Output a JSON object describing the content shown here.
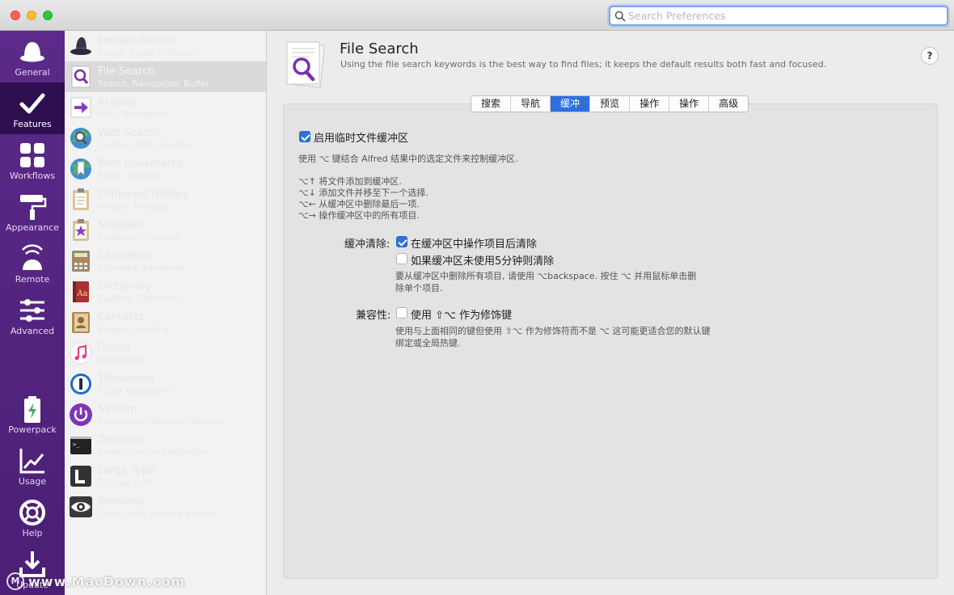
{
  "search": {
    "placeholder": "Search Preferences"
  },
  "sidebar": {
    "items": [
      {
        "label": "General",
        "icon": "hat-icon"
      },
      {
        "label": "Features",
        "icon": "checkmark-icon"
      },
      {
        "label": "Workflows",
        "icon": "grid-icon"
      },
      {
        "label": "Appearance",
        "icon": "paint-roller-icon"
      },
      {
        "label": "Remote",
        "icon": "remote-icon"
      },
      {
        "label": "Advanced",
        "icon": "sliders-icon"
      },
      {
        "label": "Powerpack",
        "icon": "battery-icon"
      },
      {
        "label": "Usage",
        "icon": "chart-icon"
      },
      {
        "label": "Help",
        "icon": "lifebuoy-icon"
      },
      {
        "label": "Update",
        "icon": "download-icon"
      }
    ]
  },
  "features": [
    {
      "title": "Default Results",
      "subtitle": "Scope, Types, Fallbacks",
      "icon": "wizard-hat-icon"
    },
    {
      "title": "File Search",
      "subtitle": "Search, Navigation, Buffer",
      "icon": "file-search-icon"
    },
    {
      "title": "Actions",
      "subtitle": "Files, Navigation",
      "icon": "arrow-right-icon"
    },
    {
      "title": "Web Search",
      "subtitle": "Custom, URLs, History",
      "icon": "globe-search-icon"
    },
    {
      "title": "Web Bookmarks",
      "subtitle": "Safari, Chrome",
      "icon": "globe-bookmark-icon"
    },
    {
      "title": "Clipboard History",
      "subtitle": "History, Merging",
      "icon": "clipboard-icon"
    },
    {
      "title": "Snippets",
      "subtitle": "Snippets, Clippings",
      "icon": "star-clipboard-icon"
    },
    {
      "title": "Calculator",
      "subtitle": "Standard, Advanced",
      "icon": "calculator-icon"
    },
    {
      "title": "Dictionary",
      "subtitle": "Spelling, Definitions",
      "icon": "dictionary-icon"
    },
    {
      "title": "Contacts",
      "subtitle": "Viewer, Emailing",
      "icon": "contacts-icon"
    },
    {
      "title": "iTunes",
      "subtitle": "Mini Player",
      "icon": "music-note-icon"
    },
    {
      "title": "1Password",
      "subtitle": "1Click Bookmarks",
      "icon": "onepassword-icon"
    },
    {
      "title": "System",
      "subtitle": "Commands, Quitting, Ejecting",
      "icon": "power-icon"
    },
    {
      "title": "Terminal",
      "subtitle": "Prefix, Custom Integration",
      "icon": "terminal-icon"
    },
    {
      "title": "Large Type",
      "subtitle": "Display, Font",
      "icon": "large-type-icon"
    },
    {
      "title": "Previews",
      "subtitle": "Quick Look, Preview panels",
      "icon": "eye-icon"
    }
  ],
  "header": {
    "title": "File Search",
    "description": "Using the file search keywords is the best way to find files; it keeps the default results both fast and focused.",
    "help": "?"
  },
  "tabs": [
    "搜索",
    "导航",
    "缓冲",
    "预览",
    "操作",
    "操作",
    "高级"
  ],
  "buffer": {
    "enable_label": "启用临时文件缓冲区",
    "enable_checked": true,
    "intro": "使用 ⌥ 键结合 Alfred 结果中的选定文件来控制缓冲区.",
    "shortcuts": [
      "⌥↑ 将文件添加到缓冲区.",
      "⌥↓ 添加文件并移至下一个选择.",
      "⌥← 从缓冲区中删除最后一项.",
      "⌥→ 操作缓冲区中的所有项目."
    ],
    "clear_label": "缓冲清除:",
    "clear_option1": "在缓冲区中操作项目后清除",
    "clear_option1_checked": true,
    "clear_option2": "如果缓冲区未使用5分钟则清除",
    "clear_option2_checked": false,
    "clear_note": "要从缓冲区中删除所有项目, 请使用 ⌥backspace. 按住 ⌥ 并用鼠标单击删除单个项目.",
    "compat_label": "兼容性:",
    "compat_option": "使用 ⇧⌥ 作为修饰键",
    "compat_checked": false,
    "compat_note": "使用与上面相同的键但使用 ⇧⌥ 作为修饰符而不是 ⌥ 这可能更适合您的默认键绑定或全局热键."
  },
  "watermark": {
    "badge": "M",
    "text": "www.MacDown.com"
  },
  "colors": {
    "sidebar": "#4f2279",
    "accent": "#2d6fdc"
  }
}
